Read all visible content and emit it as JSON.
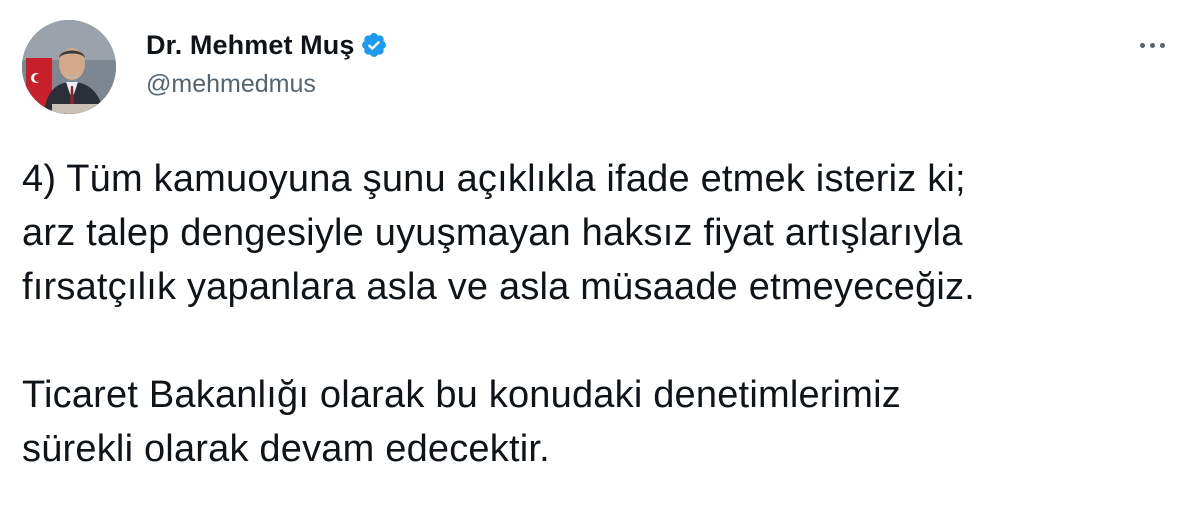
{
  "author": {
    "display_name": "Dr. Mehmet Muş",
    "handle": "@mehmedmus",
    "verified": true
  },
  "icons": {
    "verified": "verified-badge-icon",
    "more": "more-horizontal-icon"
  },
  "colors": {
    "verified_blue": "#1d9bf0",
    "secondary_text": "#536471",
    "primary_text": "#0f1419"
  },
  "tweet": {
    "paragraph1": [
      "4) Tüm kamuoyuna şunu açıklıkla ifade etmek isteriz ki;",
      "arz talep dengesiyle uyuşmayan haksız fiyat artışlarıyla",
      "fırsatçılık yapanlara asla ve asla müsaade etmeyeceğiz."
    ],
    "paragraph2": [
      "Ticaret Bakanlığı olarak bu konudaki denetimlerimiz",
      "sürekli olarak devam edecektir."
    ]
  }
}
